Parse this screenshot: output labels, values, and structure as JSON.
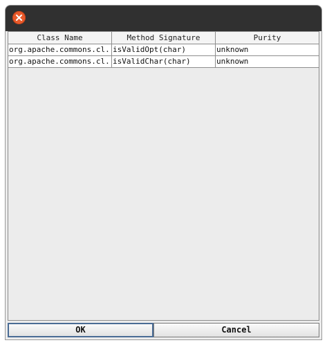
{
  "table": {
    "columns": [
      "Class Name",
      "Method Signature",
      "Purity"
    ],
    "rows": [
      [
        "org.apache.commons.cl...",
        "isValidOpt(char)",
        "unknown"
      ],
      [
        "org.apache.commons.cl...",
        "isValidChar(char)",
        "unknown"
      ]
    ]
  },
  "buttons": {
    "ok_label": "OK",
    "cancel_label": "Cancel"
  },
  "icons": {
    "close": "close-icon"
  },
  "colors": {
    "titlebar": "#303030",
    "close_button": "#e85a2b",
    "focus_border": "#4a6c95"
  }
}
